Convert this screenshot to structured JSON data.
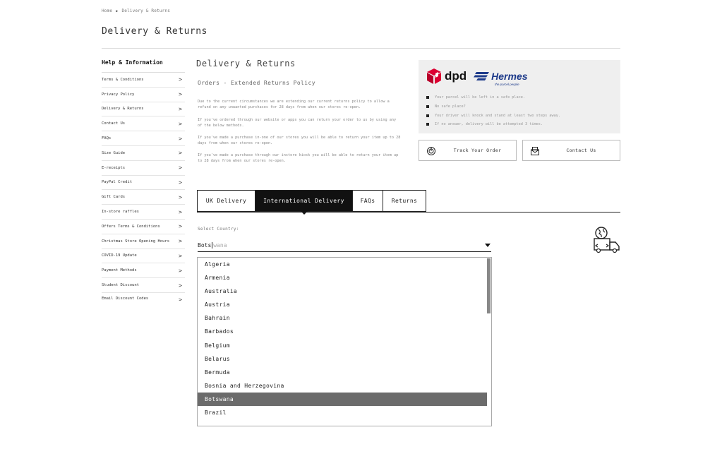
{
  "breadcrumb": {
    "home": "Home",
    "sep": "▶",
    "current": "Delivery & Returns"
  },
  "page": {
    "title": "Delivery & Returns"
  },
  "sidebar": {
    "title": "Help & Information",
    "items": [
      {
        "label": "Terms & Conditions"
      },
      {
        "label": "Privacy Policy"
      },
      {
        "label": "Delivery & Returns"
      },
      {
        "label": "Contact Us"
      },
      {
        "label": "FAQs"
      },
      {
        "label": "Size Guide"
      },
      {
        "label": "E-receipts"
      },
      {
        "label": "PayPal Credit"
      },
      {
        "label": "Gift Cards"
      },
      {
        "label": "In-store raffles"
      },
      {
        "label": "Offers Terms & Conditions"
      },
      {
        "label": "Christmas Store Opening Hours"
      },
      {
        "label": "COVID-19 Update"
      },
      {
        "label": "Payment Methods"
      },
      {
        "label": "Student Discount"
      },
      {
        "label": "Email Discount Codes"
      }
    ],
    "chevron": ">"
  },
  "main": {
    "title": "Delivery & Returns",
    "subtitle": "Orders - Extended Returns Policy",
    "paragraphs": [
      "Due to the current circumstances we are extending our current returns policy to allow a refund on any unwanted purchases for 28 days from when our stores re-open.",
      "If you've ordered through our website or apps you can return your order to us by using any of the below methods.",
      "If you've made a purchase in-one of our stores you will be able to return your item up to 28 days from when our stores re-open.",
      "If you've made a purchase through our instore kiosk you will be able to return your item up to 28 days from when our stores re-open."
    ]
  },
  "courier": {
    "dpd": "dpd",
    "hermes": "Hermes",
    "hermes_tagline": "the parcel people",
    "bullets": [
      "Your parcel will be left in a safe place.",
      "No safe place?",
      "Your driver will knock and stand at least two steps away.",
      "If no answer, delivery will be attempted 3 times."
    ],
    "colors": {
      "dpd_red": "#dc0032",
      "hermes_blue": "#1d3a8a"
    }
  },
  "actions": {
    "track": "Track Your Order",
    "contact": "Contact Us"
  },
  "tabs": [
    {
      "label": "UK Delivery",
      "active": false
    },
    {
      "label": "International Delivery",
      "active": true
    },
    {
      "label": "FAQs",
      "active": false
    },
    {
      "label": "Returns",
      "active": false
    }
  ],
  "country_select": {
    "label": "Select Country:",
    "typed": "Bots",
    "autocomplete_hint": "wana",
    "options": [
      "Algeria",
      "Armenia",
      "Australia",
      "Austria",
      "Bahrain",
      "Barbados",
      "Belgium",
      "Belarus",
      "Bermuda",
      "Bosnia and Herzegovina",
      "Botswana",
      "Brazil"
    ],
    "selected": "Botswana"
  },
  "icons": {
    "sidebar_chevron": "chevron-right-icon",
    "track": "tracking-icon",
    "contact": "mail-icon",
    "dropdown": "caret-down-icon",
    "international": "globe-truck-icon"
  }
}
